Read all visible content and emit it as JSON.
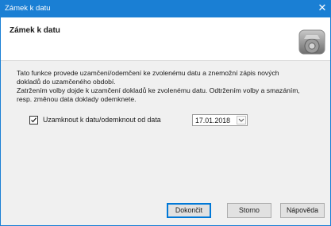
{
  "window": {
    "title": "Zámek k datu",
    "close_glyph": "✕"
  },
  "header": {
    "heading": "Zámek k datu",
    "logo_icon": "gear-icon"
  },
  "description": {
    "line1": "Tato funkce provede uzamčení/odemčení ke zvolenému datu a znemožní zápis nových",
    "line2": "dokladů do uzamčeného období.",
    "line3": "Zatržením volby dojde k uzamčení dokladů ke zvolenému datu. Odtržením volby a smazáním,",
    "line4": "resp. změnou data doklady odemknete."
  },
  "lock_option": {
    "label": "Uzamknout k datu/odemknout od data",
    "checked": true,
    "date_value": "17.01.2018"
  },
  "buttons": {
    "finish": "Dokončit",
    "cancel": "Storno",
    "help": "Nápověda"
  },
  "colors": {
    "titlebar": "#1a7fd4",
    "default_button_border": "#0078d7"
  }
}
